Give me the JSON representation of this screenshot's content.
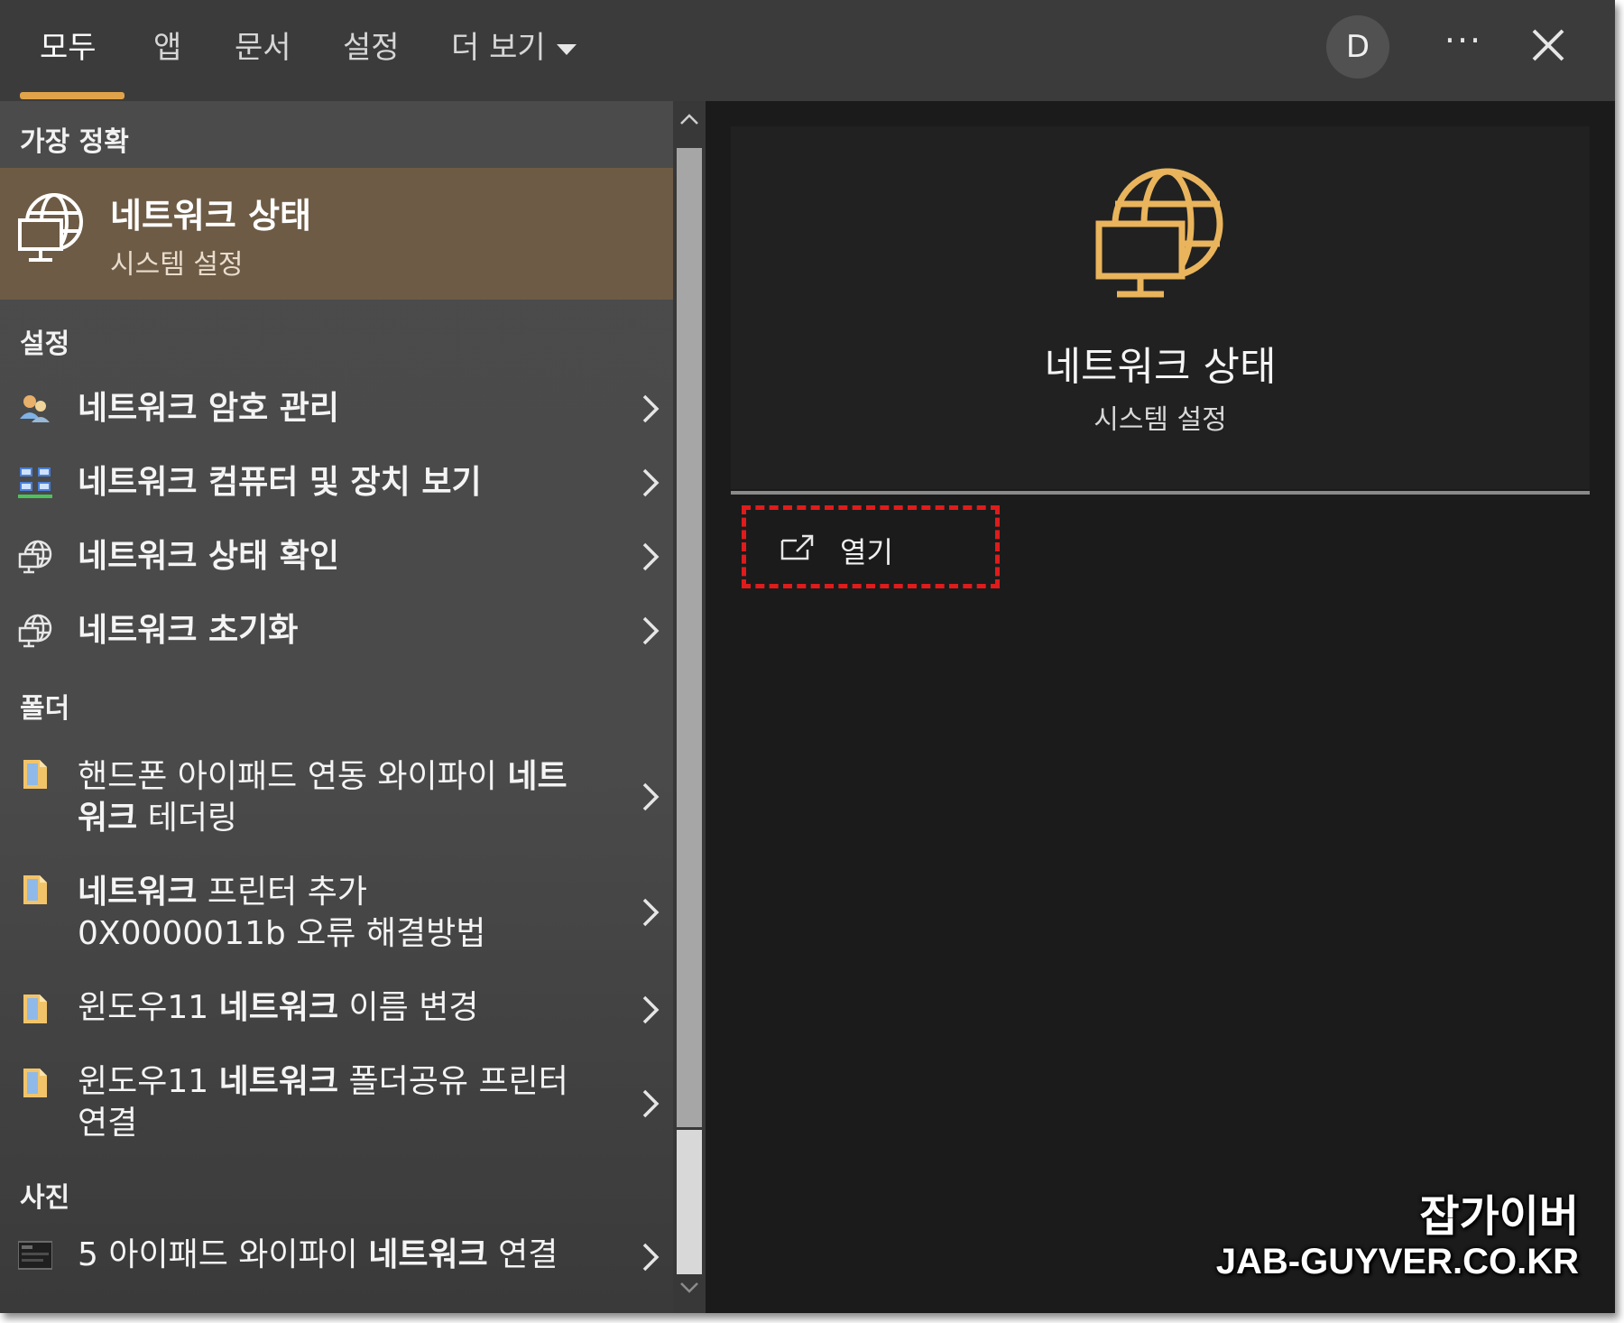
{
  "tabs": [
    {
      "label": "모두",
      "active": true
    },
    {
      "label": "앱"
    },
    {
      "label": "문서"
    },
    {
      "label": "설정"
    },
    {
      "label": "더 보기"
    }
  ],
  "header": {
    "avatar_letter": "D",
    "more_options_glyph": "···"
  },
  "best_match": {
    "section_label": "가장 정확",
    "title": "네트워크 상태",
    "subtitle": "시스템 설정",
    "icon": "network-globe-icon"
  },
  "settings_section": {
    "label": "설정",
    "items": [
      {
        "label": "네트워크 암호 관리",
        "icon": "users-icon"
      },
      {
        "label": "네트워크 컴퓨터 및 장치 보기",
        "icon": "network-computers-icon"
      },
      {
        "label": "네트워크 상태 확인",
        "icon": "network-globe-icon"
      },
      {
        "label": "네트워크 초기화",
        "icon": "network-globe-icon"
      }
    ]
  },
  "folders_section": {
    "label": "폴더",
    "items": [
      {
        "pre": "핸드폰 아이패드 연동 와이파이 ",
        "hl": "네트워크",
        "post": " 테더링",
        "icon": "folder-icon"
      },
      {
        "pre": "",
        "hl": "네트워크",
        "post": " 프린터 추가 0X0000011b 오류 해결방법",
        "icon": "folder-icon"
      },
      {
        "pre": "윈도우11 ",
        "hl": "네트워크",
        "post": " 이름 변경",
        "icon": "folder-icon"
      },
      {
        "pre": "윈도우11 ",
        "hl": "네트워크",
        "post": " 폴더공유 프린터 연결",
        "icon": "folder-icon"
      }
    ]
  },
  "photos_section": {
    "label": "사진",
    "items": [
      {
        "pre": "5 아이패드 와이파이 ",
        "hl": "네트워크",
        "post": " 연결",
        "icon": "photo-thumbnail-icon"
      }
    ]
  },
  "detail": {
    "title": "네트워크 상태",
    "subtitle": "시스템 설정",
    "open_label": "열기"
  },
  "watermark": {
    "korean": "잡가이버",
    "url": "JAB-GUYVER.CO.KR"
  },
  "colors": {
    "accent": "#e0a34a",
    "selected_row": "#6d5b45",
    "highlight_box": "#e01b1b",
    "panel_dark": "#1b1b1b"
  }
}
